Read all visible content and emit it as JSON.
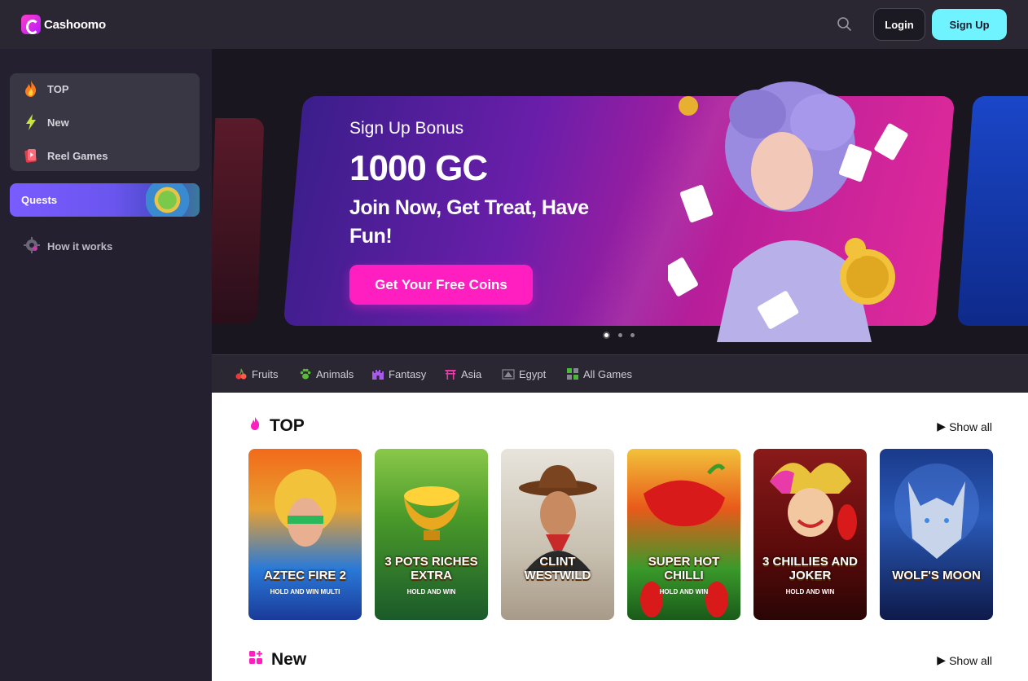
{
  "header": {
    "brand": "Cashoomo",
    "login_label": "Login",
    "signup_label": "Sign Up",
    "icons": [
      "logo-icon",
      "search-icon"
    ]
  },
  "sidebar": {
    "items": [
      {
        "label": "TOP",
        "icon": "fire-icon"
      },
      {
        "label": "New",
        "icon": "lightning-icon"
      },
      {
        "label": "Reel Games",
        "icon": "reel-games-icon"
      }
    ],
    "quests_label": "Quests",
    "how_it_works_label": "How it works"
  },
  "hero": {
    "subtitle": "Sign Up Bonus",
    "amount": "1000 GC",
    "tagline": "Join Now, Get Treat, Have Fun!",
    "cta_label": "Get Your Free Coins",
    "slide_count": 3,
    "active_slide": 1
  },
  "categories": [
    {
      "label": "Fruits",
      "icon": "cherry-icon"
    },
    {
      "label": "Animals",
      "icon": "paw-icon"
    },
    {
      "label": "Fantasy",
      "icon": "castle-icon"
    },
    {
      "label": "Asia",
      "icon": "torii-icon"
    },
    {
      "label": "Egypt",
      "icon": "pyramid-icon"
    },
    {
      "label": "All Games",
      "icon": "grid-icon"
    }
  ],
  "sections": {
    "top": {
      "title": "TOP",
      "show_all": "Show all",
      "games": [
        {
          "title": "AZTEC FIRE 2",
          "sub": "HOLD AND WIN MULTI"
        },
        {
          "title": "3 POTS RICHES EXTRA",
          "sub": "HOLD AND WIN"
        },
        {
          "title": "CLINT WESTWILD",
          "sub": ""
        },
        {
          "title": "SUPER HOT CHILLI",
          "sub": "HOLD AND WIN"
        },
        {
          "title": "3 CHILLIES AND JOKER",
          "sub": "HOLD AND WIN"
        },
        {
          "title": "WOLF'S MOON",
          "sub": ""
        }
      ]
    },
    "new": {
      "title": "New",
      "show_all": "Show all"
    }
  },
  "colors": {
    "header_bg": "#2a2733",
    "sidebar_bg": "#242030",
    "accent_pink": "#ff1ec0",
    "accent_cyan": "#6ef3ff",
    "quests_purple": "#7a5cff"
  }
}
